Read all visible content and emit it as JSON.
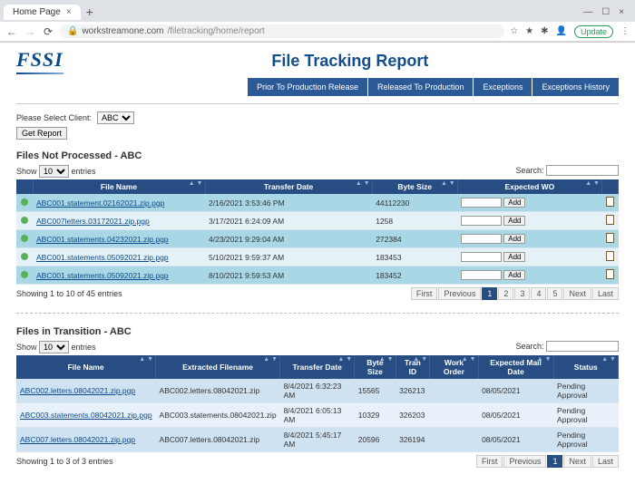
{
  "browser": {
    "tab_title": "Home Page",
    "url_lock": "🔒",
    "url_host": "workstreamone.com",
    "url_path": "/filetracking/home/report",
    "update_label": "Update"
  },
  "logo_text": "FSSI",
  "page_title": "File Tracking Report",
  "menu": [
    "Prior To Production Release",
    "Released To Production",
    "Exceptions",
    "Exceptions History"
  ],
  "client": {
    "label": "Please Select Client:",
    "selected": "ABC",
    "get_report": "Get Report"
  },
  "not_processed": {
    "title": "Files Not Processed - ABC",
    "show_label": "Show",
    "entries_label": "entries",
    "show_value": "10",
    "search_label": "Search:",
    "headers": [
      "",
      "File Name",
      "Transfer Date",
      "Byte Size",
      "Expected WO",
      ""
    ],
    "rows": [
      {
        "file": "ABC001.statement.02162021.zip.pgp",
        "date": "2/16/2021 3:53:46 PM",
        "size": "44112230",
        "add": "Add"
      },
      {
        "file": "ABC007letters.03172021.zip.pgp",
        "date": "3/17/2021 6:24:09 AM",
        "size": "1258",
        "add": "Add"
      },
      {
        "file": "ABC001.statements.04232021.zip.pgp",
        "date": "4/23/2021 9:29:04 AM",
        "size": "272384",
        "add": "Add"
      },
      {
        "file": "ABC001.statements.05092021.zip.pgp",
        "date": "5/10/2021 9:59:37 AM",
        "size": "183453",
        "add": "Add"
      },
      {
        "file": "ABC001.statements.05092021.zip.pgp",
        "date": "8/10/2021 9:59:53 AM",
        "size": "183452",
        "add": "Add"
      }
    ],
    "footer_text": "Showing 1 to 10 of 45 entries",
    "pager": {
      "first": "First",
      "prev": "Previous",
      "pages": [
        "1",
        "2",
        "3",
        "4",
        "5"
      ],
      "next": "Next",
      "last": "Last",
      "active": "1"
    }
  },
  "in_transition": {
    "title": "Files in Transition - ABC",
    "show_label": "Show",
    "entries_label": "entries",
    "show_value": "10",
    "search_label": "Search:",
    "headers": [
      "File Name",
      "Extracted Filename",
      "Transfer Date",
      "Byte Size",
      "Tran ID",
      "Work Order",
      "Expected Mail Date",
      "Status"
    ],
    "rows": [
      {
        "file": "ABC002.letters.08042021.zip.pgp",
        "extracted": "ABC002.letters.08042021.zip",
        "tdate": "8/4/2021 6:32:23 AM",
        "size": "15565",
        "tran": "326213",
        "wo": "",
        "mail": "08/05/2021",
        "status": "Pending Approval"
      },
      {
        "file": "ABC003.statements.08042021.zip.pgp",
        "extracted": "ABC003.statements.08042021.zip",
        "tdate": "8/4/2021 6:05:13 AM",
        "size": "10329",
        "tran": "326203",
        "wo": "",
        "mail": "08/05/2021",
        "status": "Pending Approval"
      },
      {
        "file": "ABC007.letters.08042021.zip.pgp",
        "extracted": "ABC007.letters.08042021.zip",
        "tdate": "8/4/2021 5:45:17 AM",
        "size": "20596",
        "tran": "326194",
        "wo": "",
        "mail": "08/05/2021",
        "status": "Pending Approval"
      }
    ],
    "footer_text": "Showing 1 to 3 of 3 entries",
    "pager": {
      "first": "First",
      "prev": "Previous",
      "pages": [
        "1"
      ],
      "next": "Next",
      "last": "Last",
      "active": "1"
    }
  }
}
